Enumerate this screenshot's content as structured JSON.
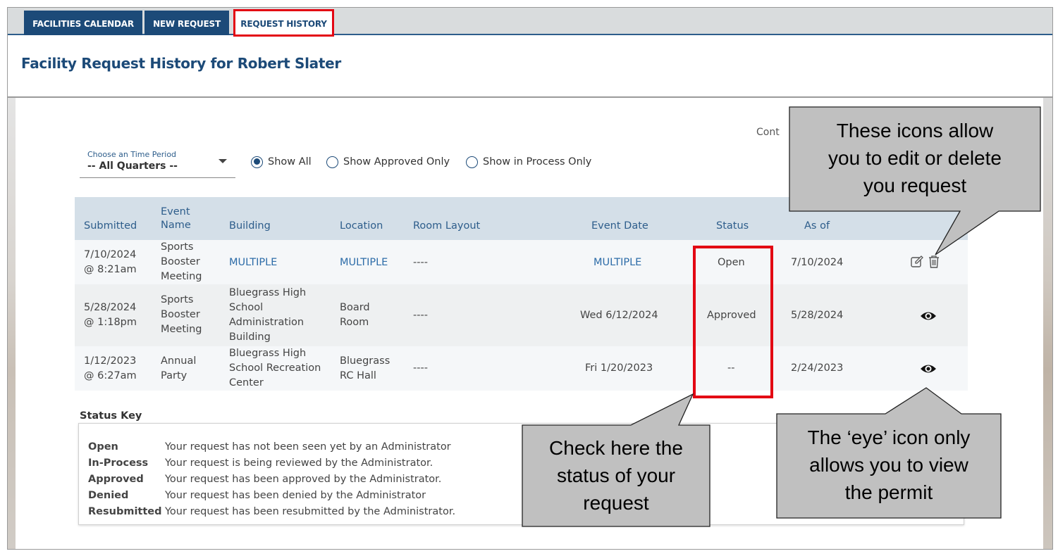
{
  "tabs": [
    {
      "label": "FACILITIES CALENDAR"
    },
    {
      "label": "NEW REQUEST"
    },
    {
      "label": "REQUEST HISTORY"
    }
  ],
  "page_title": "Facility Request History for Robert Slater",
  "cont_fragment": "Cont",
  "filter": {
    "period_label": "Choose an Time Period",
    "period_value": "-- All Quarters --",
    "radios": [
      {
        "label": "Show All",
        "selected": true
      },
      {
        "label": "Show Approved Only",
        "selected": false
      },
      {
        "label": "Show in Process Only",
        "selected": false
      }
    ]
  },
  "table": {
    "headers": {
      "submitted": "Submitted",
      "event_name_1": "Event",
      "event_name_2": "Name",
      "building": "Building",
      "location": "Location",
      "room_layout": "Room Layout",
      "event_date": "Event Date",
      "status": "Status",
      "as_of": "As of"
    },
    "rows": [
      {
        "submitted_date": "7/10/2024",
        "submitted_time": "@ 8:21am",
        "event_l1": "Sports",
        "event_l2": "Booster",
        "event_l3": "Meeting",
        "building": "MULTIPLE",
        "location": "MULTIPLE",
        "room_layout": "----",
        "event_date": "MULTIPLE",
        "status": "Open",
        "as_of": "7/10/2024",
        "actions": [
          "edit-icon",
          "trash-icon"
        ]
      },
      {
        "submitted_date": "5/28/2024",
        "submitted_time": "@ 1:18pm",
        "event_l1": "Sports",
        "event_l2": "Booster",
        "event_l3": "Meeting",
        "building_l1": "Bluegrass High",
        "building_l2": "School",
        "building_l3": "Administration",
        "building_l4": "Building",
        "location_l1": "Board",
        "location_l2": "Room",
        "room_layout": "----",
        "event_date": "Wed 6/12/2024",
        "status": "Approved",
        "as_of": "5/28/2024",
        "actions": [
          "eye-icon"
        ]
      },
      {
        "submitted_date": "1/12/2023",
        "submitted_time": "@ 6:27am",
        "event_l1": "Annual",
        "event_l2": "Party",
        "building_l1": "Bluegrass High",
        "building_l2": "School Recreation",
        "building_l3": "Center",
        "location_l1": "Bluegrass",
        "location_l2": "RC Hall",
        "room_layout": "----",
        "event_date": "Fri 1/20/2023",
        "status": "--",
        "as_of": "2/24/2023",
        "actions": [
          "eye-icon"
        ]
      }
    ]
  },
  "status_key": {
    "title": "Status Key",
    "items": [
      {
        "term": "Open",
        "desc": "Your request has not been seen yet by an Administrator"
      },
      {
        "term": "In-Process",
        "desc": "Your request is being reviewed by the Administrator."
      },
      {
        "term": "Approved",
        "desc": "Your request has been approved by the Administrator."
      },
      {
        "term": "Denied",
        "desc": "Your request has been denied by the Administrator"
      },
      {
        "term": "Resubmitted",
        "desc": "Your request has been resubmitted by the Administrator."
      }
    ]
  },
  "callouts": {
    "edit_delete": {
      "l1": "These icons allow",
      "l2": "you to edit or delete",
      "l3": "you request"
    },
    "status": {
      "l1": "Check here the",
      "l2": "status of your",
      "l3": "request"
    },
    "eye": {
      "l1": "The ‘eye’ icon only",
      "l2": "allows you to view",
      "l3": "the permit"
    }
  },
  "colors": {
    "brand_navy": "#1c4a78",
    "link_blue": "#2d6ca8",
    "highlight_red": "#e30613",
    "callout_fill": "#c0c0c0"
  }
}
